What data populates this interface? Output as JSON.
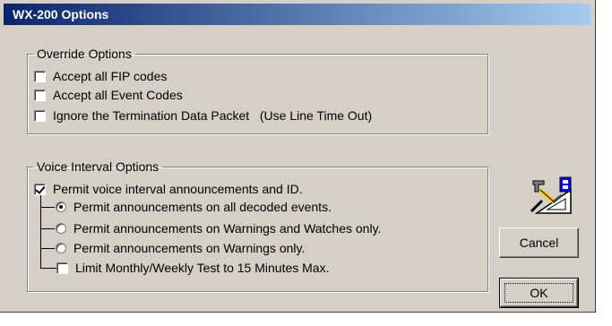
{
  "window": {
    "title": "WX-200 Options"
  },
  "override_options": {
    "label": "Override Options",
    "items": [
      {
        "label": "Accept all FIP codes",
        "checked": false
      },
      {
        "label": "Accept all Event Codes",
        "checked": false
      },
      {
        "label": "Ignore the Termination Data Packet   (Use Line Time Out)",
        "checked": false
      }
    ]
  },
  "voice_interval_options": {
    "label": "Voice Interval Options",
    "permit": {
      "label": "Permit voice interval announcements and ID.",
      "checked": true
    },
    "radios": [
      {
        "label": "Permit announcements on all decoded events.",
        "selected": true
      },
      {
        "label": "Permit announcements on Warnings and Watches only.",
        "selected": false
      },
      {
        "label": "Permit announcements on Warnings only.",
        "selected": false
      }
    ],
    "limit_test": {
      "label": "Limit Monthly/Weekly Test to 15 Minutes Max.",
      "checked": false
    }
  },
  "buttons": {
    "cancel": "Cancel",
    "ok": "OK"
  },
  "icons": {
    "settings_tool": "settings-tool-icon"
  },
  "colors": {
    "face": "#d4d0c8",
    "title_start": "#0a246a",
    "title_end": "#a6caf0"
  }
}
